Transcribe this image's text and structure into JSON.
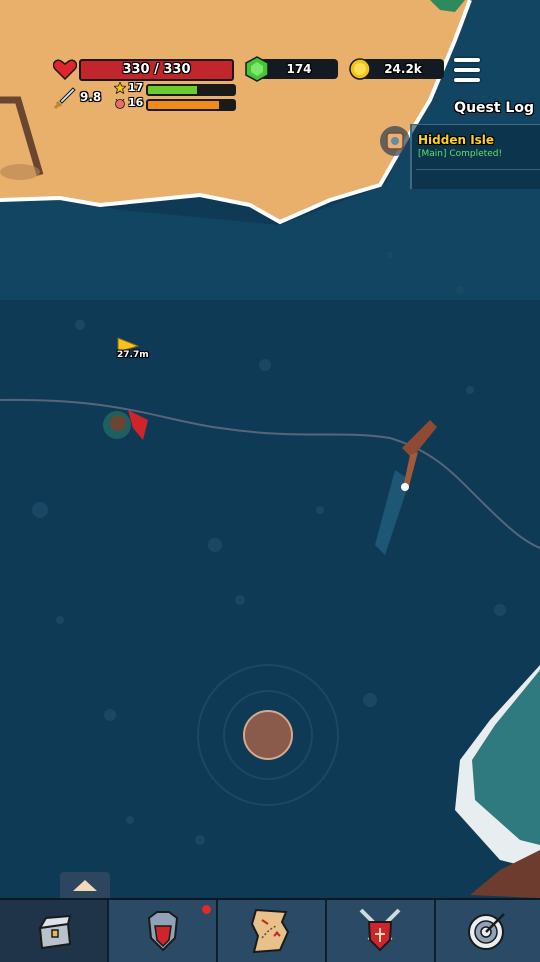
{
  "hud": {
    "hp_text": "330 / 330",
    "hp_fraction": 1.0,
    "gems": "174",
    "gold": "24.2k",
    "attack": "9.8",
    "level": "17",
    "level_xp_fraction": 0.57,
    "rage_level": "16",
    "rage_fraction": 0.82
  },
  "quest_log": {
    "title": "Quest Log",
    "quest_name": "Hidden Isle",
    "quest_status": "[Main] Completed!"
  },
  "world": {
    "distance_marker": "27.7m"
  },
  "colors": {
    "ocean": "#0e3a55",
    "sand": "#e8b06a",
    "hp_red": "#c0262b",
    "xp_green": "#6ecb2f",
    "rage_orange": "#f08c1c",
    "quest_yellow": "#ffd31c",
    "quest_green": "#5fe05f"
  },
  "nav": {
    "items": [
      "treasure-chest-icon",
      "armor-icon",
      "treasure-map-icon",
      "crossed-swords-shield-icon",
      "target-icon"
    ],
    "notification_on": "armor"
  }
}
